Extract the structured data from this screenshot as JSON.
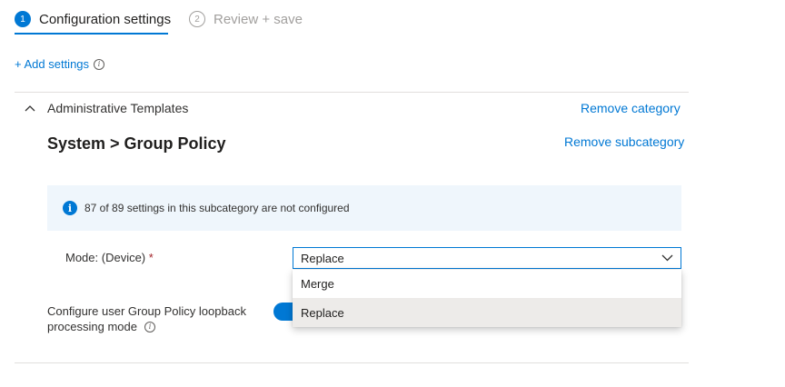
{
  "wizard": {
    "steps": [
      {
        "number": "1",
        "label": "Configuration settings",
        "state": "active"
      },
      {
        "number": "2",
        "label": "Review + save",
        "state": "inactive"
      }
    ]
  },
  "add_settings": {
    "label": "+ Add settings",
    "info_icon": "info-icon"
  },
  "category": {
    "title": "Administrative Templates",
    "remove_label": "Remove category",
    "collapse_icon": "chevron-up-icon"
  },
  "subcategory": {
    "title": "System > Group Policy",
    "remove_label": "Remove subcategory"
  },
  "banner": {
    "icon": "info-icon",
    "text": "87 of 89 settings in this subcategory are not configured"
  },
  "mode_setting": {
    "label": "Mode: (Device)",
    "required_mark": "*",
    "selected": "Replace",
    "options": [
      "Merge",
      "Replace"
    ],
    "highlighted_option": "Replace"
  },
  "loopback_setting": {
    "label_line1": "Configure user Group Policy loopback",
    "label_line2": "processing mode"
  },
  "colors": {
    "accent": "#0078d4",
    "required": "#a4262c",
    "banner_bg": "#eff6fc"
  }
}
